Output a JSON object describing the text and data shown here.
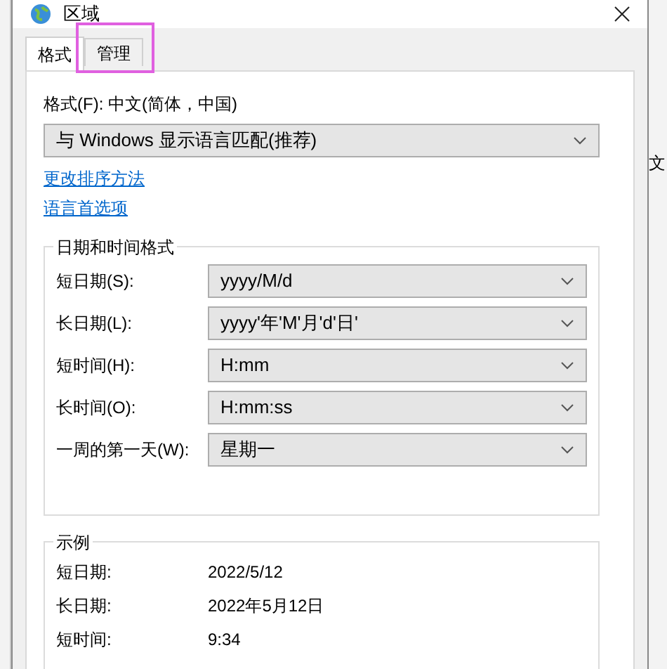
{
  "window": {
    "title": "区域"
  },
  "background_window": {
    "text": "文"
  },
  "tabs": [
    {
      "label": "格式",
      "selected": true,
      "highlighted": false
    },
    {
      "label": "管理",
      "selected": false,
      "highlighted": true
    }
  ],
  "format": {
    "label": "格式(F): 中文(简体，中国)",
    "value": "与 Windows 显示语言匹配(推荐)"
  },
  "links": [
    "更改排序方法",
    "语言首选项"
  ],
  "date_time_formats": {
    "title": "日期和时间格式",
    "rows": [
      {
        "label": "短日期(S):",
        "value": "yyyy/M/d"
      },
      {
        "label": "长日期(L):",
        "value": "yyyy'年'M'月'd'日'"
      },
      {
        "label": "短时间(H):",
        "value": "H:mm"
      },
      {
        "label": "长时间(O):",
        "value": "H:mm:ss"
      },
      {
        "label": "一周的第一天(W):",
        "value": "星期一"
      }
    ]
  },
  "examples": {
    "title": "示例",
    "rows": [
      {
        "label": "短日期:",
        "value": "2022/5/12"
      },
      {
        "label": "长日期:",
        "value": "2022年5月12日"
      },
      {
        "label": "短时间:",
        "value": "9:34"
      }
    ]
  }
}
